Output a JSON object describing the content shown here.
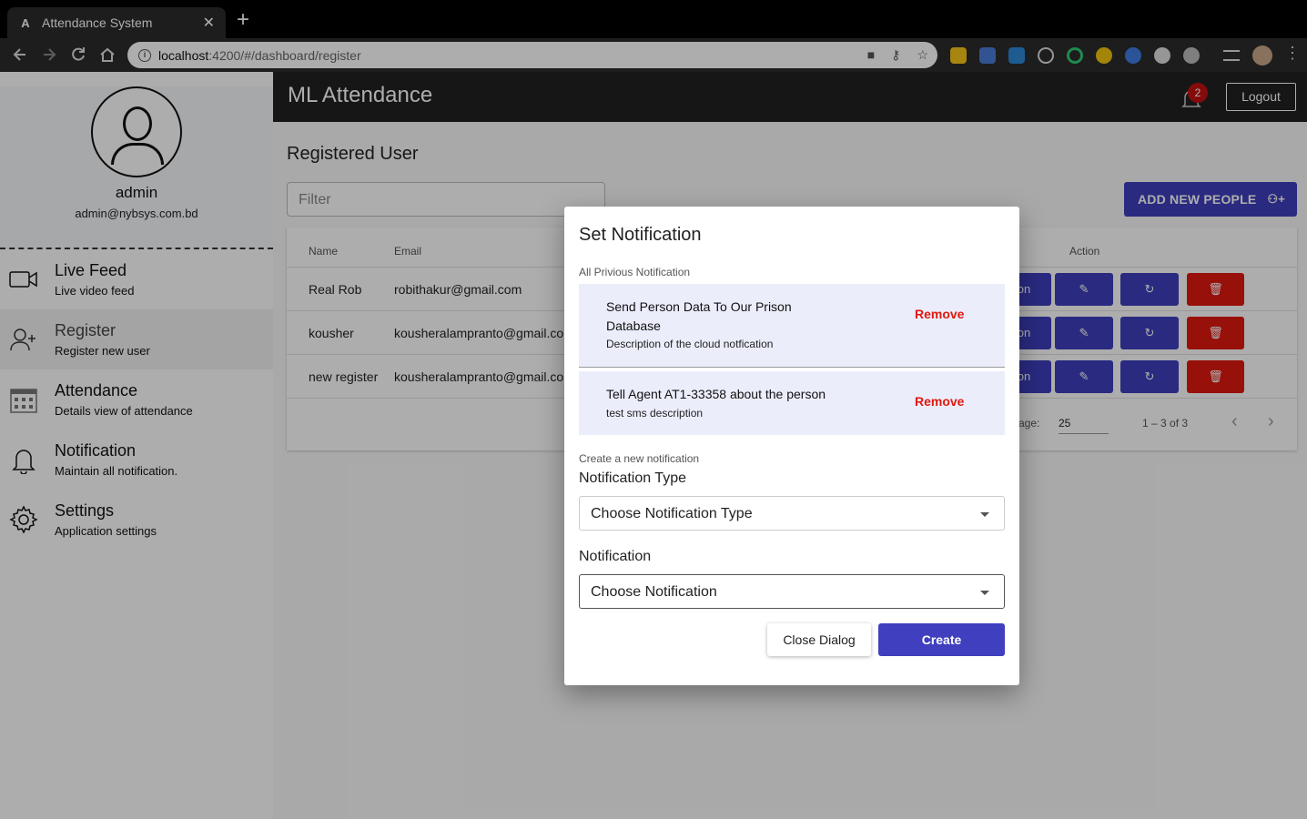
{
  "browser": {
    "tab_title": "Attendance System",
    "tab_close": "✕",
    "new_tab": "+",
    "url_host": "localhost",
    "url_path": ":4200/#/dashboard/register",
    "favicon_letter": "A"
  },
  "sidebar": {
    "user_name": "admin",
    "user_email": "admin@nybsys.com.bd",
    "items": [
      {
        "title": "Live Feed",
        "subtitle": "Live video feed",
        "icon": "video-camera-icon"
      },
      {
        "title": "Register",
        "subtitle": "Register new user",
        "icon": "add-user-icon",
        "active": true
      },
      {
        "title": "Attendance",
        "subtitle": "Details view of attendance",
        "icon": "calendar-icon"
      },
      {
        "title": "Notification",
        "subtitle": "Maintain all notification.",
        "icon": "bell-icon"
      },
      {
        "title": "Settings",
        "subtitle": "Application settings",
        "icon": "gear-icon"
      }
    ]
  },
  "header": {
    "app_title": "ML Attendance",
    "notification_count": "2",
    "logout_label": "Logout"
  },
  "page": {
    "title": "Registered User",
    "filter_placeholder": "Filter",
    "add_button_label": "ADD NEW PEOPLE",
    "table": {
      "columns": [
        "Name",
        "Email",
        "Action"
      ],
      "rows": [
        {
          "name": "Real Rob",
          "email": "robithakur@gmail.com"
        },
        {
          "name": "kousher",
          "email": "kousheralampranto@gmail.com"
        },
        {
          "name": "new register",
          "email": "kousheralampranto@gmail.com"
        }
      ],
      "action_partial_label": "on"
    },
    "pager": {
      "items_per_page_label": "r page:",
      "page_size": "25",
      "range": "1 – 3 of 3"
    }
  },
  "dialog": {
    "title": "Set Notification",
    "previous_label": "All Privious Notification",
    "notifications": [
      {
        "title": "Send Person Data To Our Prison Database",
        "description": "Description of the cloud notfication",
        "remove_label": "Remove"
      },
      {
        "title": "Tell Agent AT1-33358 about the person",
        "description": "test sms description",
        "remove_label": "Remove"
      }
    ],
    "create_label": "Create a new notification",
    "type_label": "Notification Type",
    "type_value": "Choose Notification Type",
    "notification_label": "Notification",
    "notification_value": "Choose Notification",
    "close_button": "Close Dialog",
    "create_button": "Create"
  },
  "colors": {
    "primary": "#3f3fbf",
    "danger": "#e0190f",
    "appbar": "#212121"
  }
}
